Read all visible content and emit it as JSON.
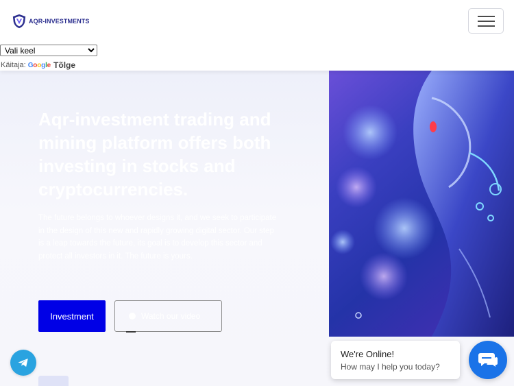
{
  "header": {
    "logo_text": "AQR-INVESTMENTS",
    "logo_icon": "shield-logo-icon",
    "menu_icon": "hamburger-menu-icon"
  },
  "translate": {
    "select_value": "Vali keel",
    "powered_label": "Käitaja:",
    "google_word": "Google",
    "link_label": "Tõlge"
  },
  "hero": {
    "title": "Aqr-investment trading and mining platform offers both investing in stocks and cryptocurrencies.",
    "description": "The future belongs to whoever designs it, and we seek to participate in the design of this new and rapidly growing digital sector. Our step is a leap towards the future, its goal is to develop this sector and protect all investors in it. The future is yours.",
    "primary_button": "Investment",
    "secondary_button": "Watch our video",
    "image": "robot-ai-illustration"
  },
  "chat": {
    "title": "We're Online!",
    "subtitle": "How may I help you today?",
    "icon": "chat-bubble-icon"
  },
  "floating": {
    "telegram_icon": "telegram-icon"
  },
  "colors": {
    "brand_primary": "#0000e6",
    "logo_text": "#2c2f8f",
    "chat_launcher": "#1a73e8",
    "telegram": "#2aa3e0",
    "hero_background": "#f4f5fb"
  }
}
